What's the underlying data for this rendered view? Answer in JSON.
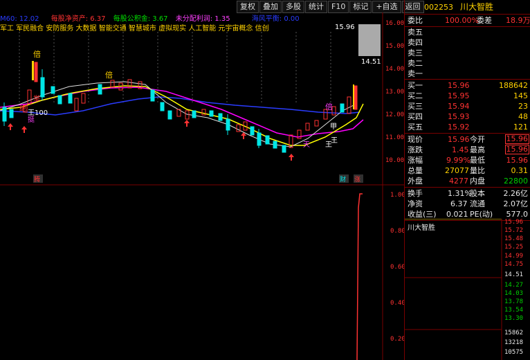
{
  "toolbar": {
    "buttons": [
      "复权",
      "叠加",
      "多股",
      "统计",
      "F10",
      "标记",
      "+自选",
      "返回"
    ]
  },
  "info_bar": {
    "ma_label": "M60: 12.02",
    "nav_label": "每股净资产: 6.37",
    "reserve_label": "每股公积金: 3.67",
    "undistributed_label": "未分配利润: 1.35",
    "risk_label": "海风平衡: 0.00"
  },
  "concepts": "军工 军民融合 安防服务 大数据 智能交通 智慧城市 虚拟现实 人工智能 元宇宙概念 信创",
  "chart_marks": {
    "bei1": "倍",
    "bei2": "倍",
    "bei3": "倍",
    "ju": "举",
    "jue": "绝",
    "wang100": "王100",
    "ting": "挺",
    "tian": "天",
    "jia": "甲",
    "wang": "王",
    "wang2": "王",
    "teng": "腾",
    "cai": "财",
    "zhang": "涨"
  },
  "price_axis": {
    "labels": [
      "16.00",
      "15.00",
      "14.00",
      "13.00",
      "12.00",
      "11.00",
      "10.00"
    ],
    "high_label": "15.96",
    "low_label": "14.51"
  },
  "volume_axis": {
    "labels": [
      "1.00",
      "0.80",
      "0.60",
      "0.40",
      "0.20"
    ]
  },
  "quote": {
    "code": "002253",
    "name": "川大智胜",
    "weibi_label": "委比",
    "weibi_value": "100.00%",
    "weicha_label": "委差",
    "weicha_value": "18.9万",
    "sell": [
      {
        "label": "卖五",
        "price": "",
        "vol": ""
      },
      {
        "label": "卖四",
        "price": "",
        "vol": ""
      },
      {
        "label": "卖三",
        "price": "",
        "vol": ""
      },
      {
        "label": "卖二",
        "price": "",
        "vol": ""
      },
      {
        "label": "卖一",
        "price": "",
        "vol": ""
      }
    ],
    "buy": [
      {
        "label": "买一",
        "price": "15.96",
        "vol": "188642"
      },
      {
        "label": "买二",
        "price": "15.95",
        "vol": "145"
      },
      {
        "label": "买三",
        "price": "15.94",
        "vol": "23"
      },
      {
        "label": "买四",
        "price": "15.93",
        "vol": "48"
      },
      {
        "label": "买五",
        "price": "15.92",
        "vol": "121"
      }
    ],
    "stats": [
      {
        "l1": "现价",
        "v1": "15.96",
        "l2": "今开",
        "v2": "15.96"
      },
      {
        "l1": "涨跌",
        "v1": "1.45",
        "l2": "最高",
        "v2": "15.96"
      },
      {
        "l1": "涨幅",
        "v1": "9.99%",
        "l2": "最低",
        "v2": "15.96"
      },
      {
        "l1": "总量",
        "v1": "27077",
        "l2": "量比",
        "v2": "0.31"
      },
      {
        "l1": "外盘",
        "v1": "4277",
        "l2": "内盘",
        "v2": "22800"
      }
    ],
    "fundamentals": [
      {
        "l1": "换手",
        "v1": "1.31%",
        "l2": "股本",
        "v2": "2.26亿"
      },
      {
        "l1": "净资",
        "v1": "6.37",
        "l2": "流通",
        "v2": "2.07亿"
      },
      {
        "l1": "收益(三)",
        "v1": "0.021",
        "l2": "PE(动)",
        "v2": "577.0"
      }
    ],
    "mini_title": "川大智胜",
    "mini_axis": [
      "15.96",
      "15.72",
      "15.48",
      "15.25",
      "14.99",
      "14.75",
      "14.51",
      "14.27",
      "14.03",
      "13.78",
      "13.54",
      "13.30",
      "15862",
      "13218",
      "10575"
    ]
  },
  "colors": {
    "up": "#ff3232",
    "down": "#00e6e6",
    "ma5": "#ffffff",
    "ma10": "#ffff00",
    "ma20": "#ff00ff",
    "ma60": "#2a3cff"
  }
}
